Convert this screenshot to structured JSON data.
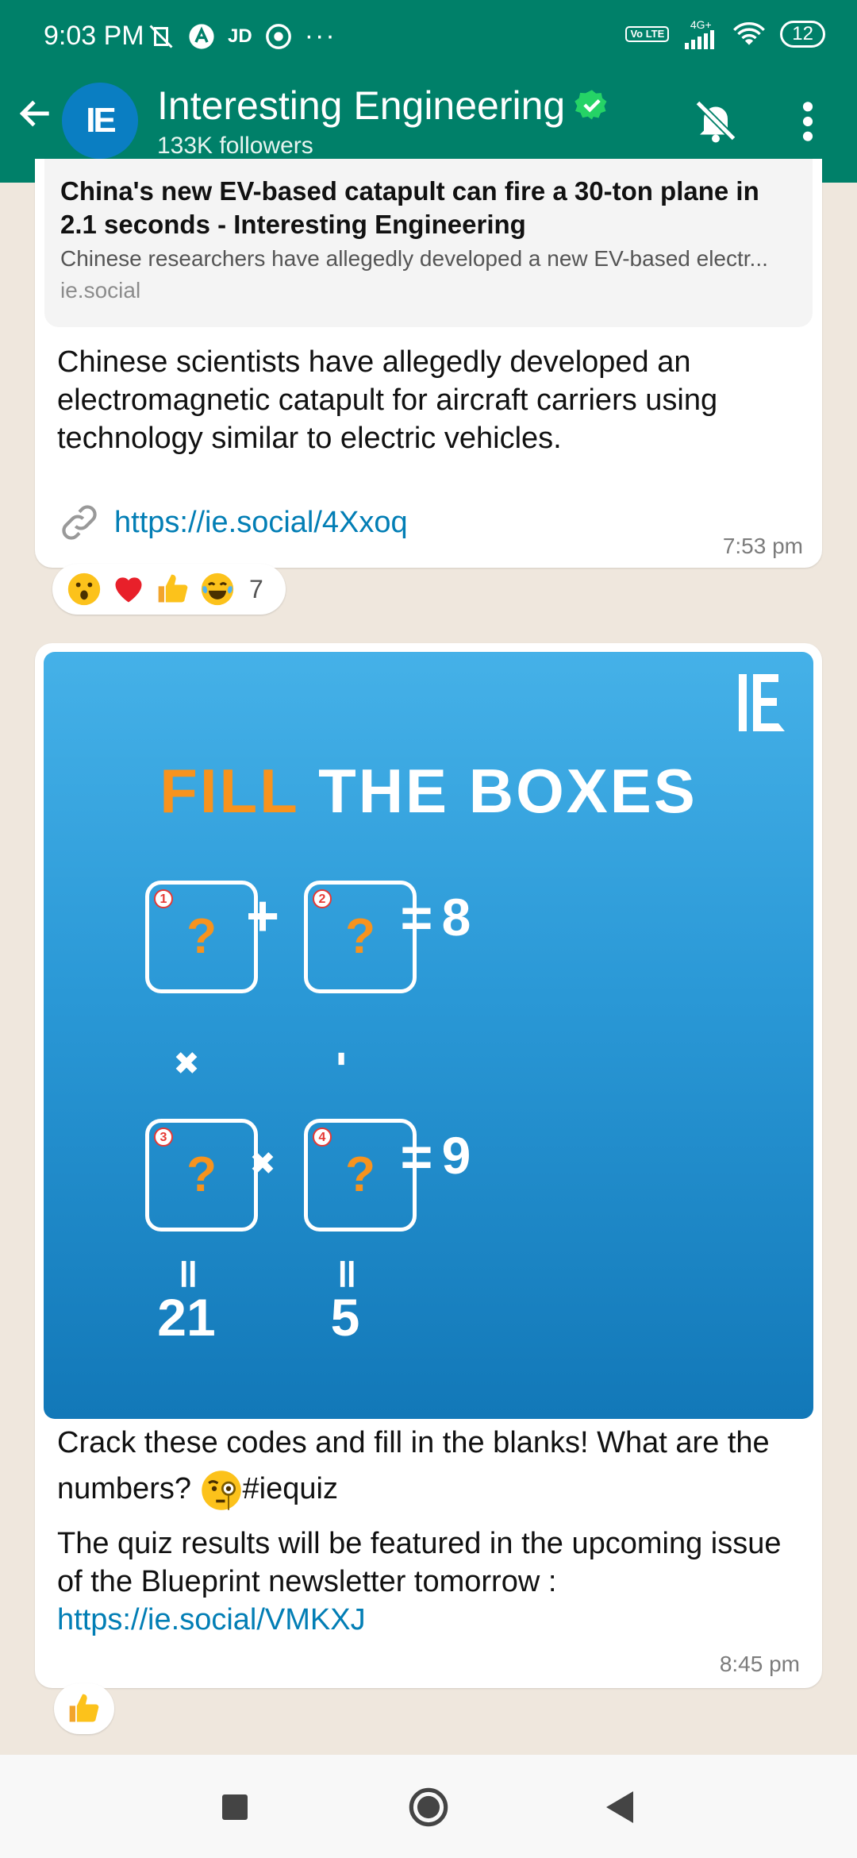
{
  "status_bar": {
    "time": "9:03 PM",
    "left_icons": [
      "mute-icon",
      "a-icon",
      "jd-icon",
      "browser-icon",
      "more-dots"
    ],
    "jd_label": "JD",
    "more_label": "···",
    "volte_label": "Vo LTE",
    "network_label": "4G+",
    "battery": "12"
  },
  "header": {
    "avatar_text": "IE",
    "title": "Interesting Engineering",
    "followers": "133K followers"
  },
  "message1": {
    "preview_title": "China's new EV-based catapult can fire a 30-ton plane in 2.1 seconds - Interesting Engineering",
    "preview_desc": "Chinese researchers have allegedly developed a new EV-based electr...",
    "preview_domain": "ie.social",
    "text": "Chinese scientists have allegedly developed an electromagnetic catapult for aircraft carriers using technology similar to electric vehicles.",
    "link": "https://ie.social/4Xxoq",
    "time": "7:53 pm",
    "reactions": [
      "surprised-face",
      "red-heart",
      "thumbs-up",
      "tears-of-joy"
    ],
    "reaction_count": "7"
  },
  "message2": {
    "image": {
      "title_orange": "FILL",
      "title_white": "THE BOXES",
      "box_mark": "?",
      "box_numbers": [
        "1",
        "2",
        "3",
        "4"
      ],
      "plus": "+",
      "equals": "=",
      "times": "✖",
      "minus": "-",
      "eq_vertical": "॥",
      "result_row1": "8",
      "result_row2": "9",
      "result_col1": "21",
      "result_col2": "5"
    },
    "caption_part1": "Crack these codes and fill in the blanks! What are the numbers?",
    "caption_hashtag": "#iequiz",
    "caption2": "The quiz results will be featured in the upcoming issue of the Blueprint newsletter tomorrow :",
    "link": "https://ie.social/VMKXJ",
    "time": "8:45 pm",
    "reactions": [
      "thumbs-up"
    ]
  },
  "colors": {
    "header_green": "#008069",
    "link_blue": "#027eb5",
    "quiz_orange": "#f7931e",
    "chat_bg": "#efe7dd"
  }
}
